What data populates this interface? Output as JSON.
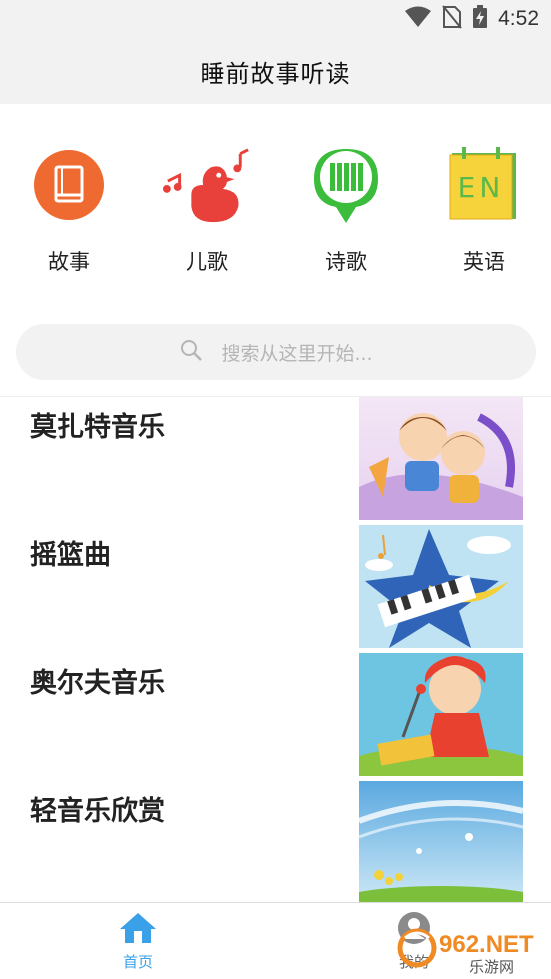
{
  "status": {
    "time": "4:52"
  },
  "header": {
    "title": "睡前故事听读"
  },
  "categories": [
    {
      "label": "故事",
      "icon": "book-icon"
    },
    {
      "label": "儿歌",
      "icon": "duck-music-icon"
    },
    {
      "label": "诗歌",
      "icon": "bamboo-scroll-icon"
    },
    {
      "label": "英语",
      "icon": "english-book-icon"
    }
  ],
  "search": {
    "placeholder": "搜索从这里开始..."
  },
  "list": [
    {
      "title": "莫扎特音乐"
    },
    {
      "title": "摇篮曲"
    },
    {
      "title": "奥尔夫音乐"
    },
    {
      "title": "轻音乐欣赏"
    }
  ],
  "tabs": [
    {
      "label": "首页",
      "active": true
    },
    {
      "label": "我的",
      "active": false
    }
  ],
  "watermark": {
    "brand": "962.NET",
    "sub": "乐游网"
  },
  "colors": {
    "accent": "#3aa0e8",
    "orange": "#ef6a30",
    "red": "#e8413c",
    "green": "#3bbd3b",
    "yellow": "#f6d33a"
  }
}
